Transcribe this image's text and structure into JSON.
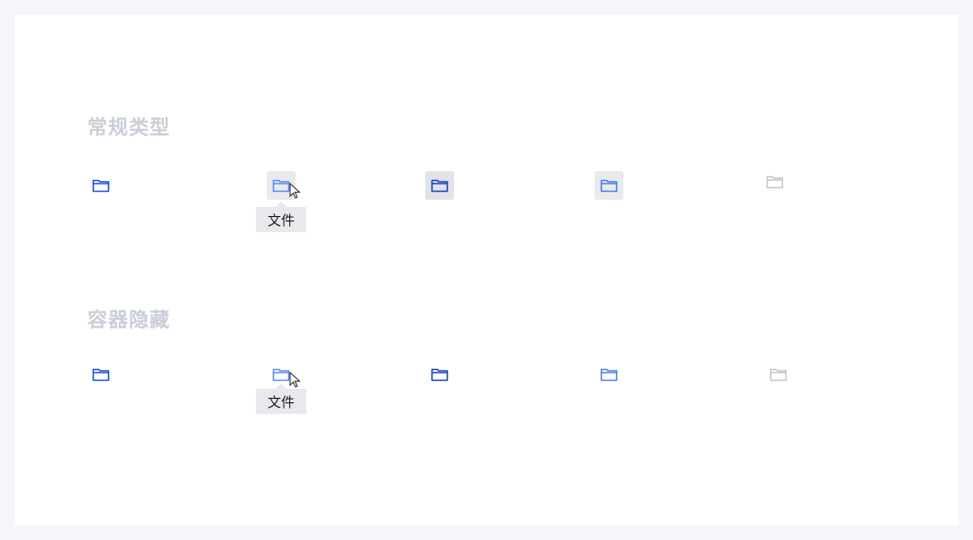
{
  "sections": [
    {
      "title": "常规类型",
      "states": [
        {
          "name": "default",
          "icon": "folder-icon",
          "color": "#1d4ed8",
          "background": "none"
        },
        {
          "name": "hover",
          "icon": "folder-icon",
          "color": "#5b8def",
          "background": "#e8eaee",
          "tooltip": "文件"
        },
        {
          "name": "active",
          "icon": "folder-icon",
          "color": "#1741b8",
          "background": "#e1e3e8"
        },
        {
          "name": "focus",
          "icon": "folder-icon",
          "color": "#4a7fe8",
          "background": "#e8eaee"
        },
        {
          "name": "disabled",
          "icon": "folder-icon",
          "color": "#bfc3ca",
          "background": "none"
        }
      ]
    },
    {
      "title": "容器隐藏",
      "states": [
        {
          "name": "default",
          "icon": "folder-icon",
          "color": "#1d4ed8"
        },
        {
          "name": "hover",
          "icon": "folder-icon",
          "color": "#5b8def",
          "tooltip": "文件"
        },
        {
          "name": "active",
          "icon": "folder-icon",
          "color": "#1741b8"
        },
        {
          "name": "focus",
          "icon": "folder-icon",
          "color": "#4a7fe8"
        },
        {
          "name": "disabled",
          "icon": "folder-icon",
          "color": "#bfc3ca"
        }
      ]
    }
  ],
  "colors": {
    "page_background": "#f5f6fa",
    "canvas_background": "#ffffff",
    "title_text": "#c9ced8"
  }
}
